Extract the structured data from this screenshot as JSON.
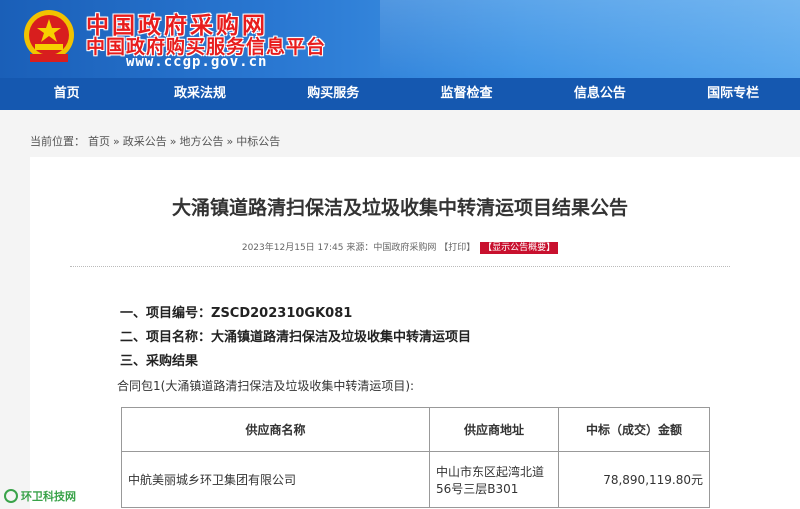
{
  "header": {
    "title": "中国政府采购网",
    "subtitle": "中国政府购买服务信息平台",
    "url": "www.ccgp.gov.cn"
  },
  "nav": {
    "items": [
      {
        "label": "首页"
      },
      {
        "label": "政采法规"
      },
      {
        "label": "购买服务"
      },
      {
        "label": "监督检查"
      },
      {
        "label": "信息公告"
      },
      {
        "label": "国际专栏"
      }
    ]
  },
  "breadcrumb": {
    "prefix": "当前位置：",
    "items": [
      "首页",
      "政采公告",
      "地方公告",
      "中标公告"
    ],
    "separator": "»"
  },
  "article": {
    "title": "大涌镇道路清扫保洁及垃圾收集中转清运项目结果公告",
    "datetime": "2023年12月15日 17:45",
    "source": "来源：中国政府采购网",
    "print": "【打印】",
    "summary_tag": "【显示公告概要】",
    "line1_label": "一、项目编号：",
    "line1_value": "ZSCD202310GK081",
    "line2_label": "二、项目名称：",
    "line2_value": "大涌镇道路清扫保洁及垃圾收集中转清运项目",
    "line3_label": "三、采购结果",
    "package": "合同包1(大涌镇道路清扫保洁及垃圾收集中转清运项目):",
    "table": {
      "headers": [
        "供应商名称",
        "供应商地址",
        "中标（成交）金额"
      ],
      "rows": [
        [
          "中航美丽城乡环卫集团有限公司",
          "中山市东区起湾北道56号三层B301",
          "78,890,119.80元"
        ]
      ]
    }
  },
  "watermark": "环卫科技网",
  "colors": {
    "nav": "#1558b0",
    "title_red": "#e81d1d",
    "tag_red": "#c8102e"
  }
}
